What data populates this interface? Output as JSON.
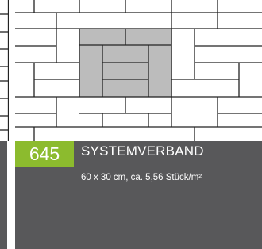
{
  "product": {
    "code": "645",
    "name": "SYSTEMVERBAND",
    "spec": "60 x 30 cm, ca. 5,56 Stück/m²"
  },
  "colors": {
    "badge_green": "#8cbb2e",
    "panel_gray": "#58585a",
    "highlight_stone": "#bcbcbc",
    "joint_line": "#222222"
  },
  "icons": {
    "pattern": "paving-pattern-illustration"
  }
}
